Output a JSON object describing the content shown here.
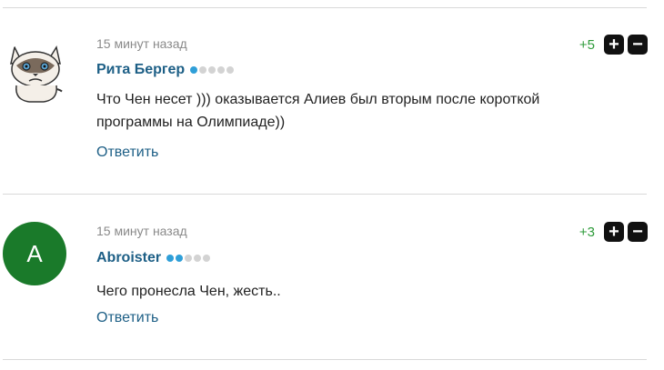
{
  "comments": [
    {
      "time": "15 минут назад",
      "author": "Рита Бергер",
      "rating_level": 1,
      "text": "Что Чен несет ))) оказывается Алиев был вторым после короткой программы на Олимпиаде))",
      "reply_label": "Ответить",
      "score": "+5",
      "avatar": {
        "type": "image",
        "icon": "grumpy-cat-avatar"
      }
    },
    {
      "time": "15 минут назад",
      "author": "Abroister",
      "rating_level": 2,
      "text": "Чего пронесла Чен, жесть..",
      "reply_label": "Ответить",
      "score": "+3",
      "avatar": {
        "type": "letter",
        "letter": "A",
        "color": "#1a7a2a"
      }
    }
  ],
  "vote_buttons": {
    "plus_icon": "plus-icon",
    "minus_icon": "minus-icon"
  },
  "colors": {
    "author": "#1d5f86",
    "score": "#2e9b3a",
    "dot_active": "#2f9fd8",
    "dot_inactive": "#d3d3d3"
  }
}
